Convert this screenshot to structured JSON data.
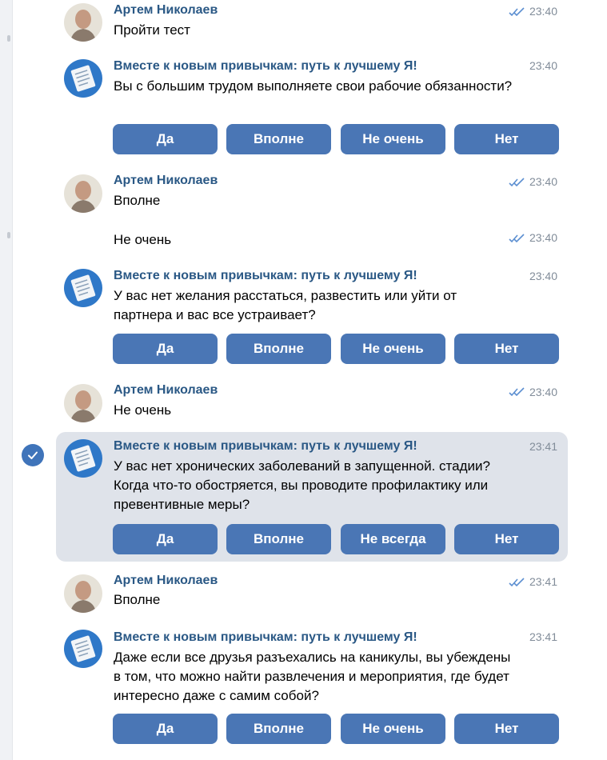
{
  "messages": [
    {
      "kind": "user",
      "sender": "Артем Николаев",
      "time": "23:40",
      "text": "Пройти тест"
    },
    {
      "kind": "bot",
      "sender": "Вместе к новым привычкам: путь к лучшему Я!",
      "time": "23:40",
      "text": "Вы с большим трудом выполняете свои рабочие обязанности?",
      "buttons": [
        "Да",
        "Вполне",
        "Не очень",
        "Нет"
      ]
    },
    {
      "kind": "user",
      "sender": "Артем Николаев",
      "time": "23:40",
      "text": "Вполне",
      "extra_text": "Не очень",
      "extra_time": "23:40"
    },
    {
      "kind": "bot",
      "sender": "Вместе к новым привычкам: путь к лучшему Я!",
      "time": "23:40",
      "text": "У вас нет желания расстаться, развестить или уйти от партнера и вас все устраивает?",
      "buttons": [
        "Да",
        "Вполне",
        "Не очень",
        "Нет"
      ]
    },
    {
      "kind": "user",
      "sender": "Артем Николаев",
      "time": "23:40",
      "text": "Не очень"
    },
    {
      "kind": "bot",
      "sender": "Вместе к новым привычкам: путь к лучшему Я!",
      "time": "23:41",
      "text": "У вас нет хронических заболеваний в запущенной. стадии? Когда что-то обостряется, вы проводите профилактику или превентивные меры?",
      "buttons": [
        "Да",
        "Вполне",
        "Не всегда",
        "Нет"
      ]
    },
    {
      "kind": "user",
      "sender": "Артем Николаев",
      "time": "23:41",
      "text": "Вполне"
    },
    {
      "kind": "bot",
      "sender": "Вместе к новым привычкам: путь к лучшему Я!",
      "time": "23:41",
      "text": "Даже если все друзья разъехались на каникулы, вы убеждены в том, что можно найти развлечения и мероприятия, где будет интересно даже с самим собой?",
      "buttons": [
        "Да",
        "Вполне",
        "Не очень",
        "Нет"
      ]
    }
  ]
}
